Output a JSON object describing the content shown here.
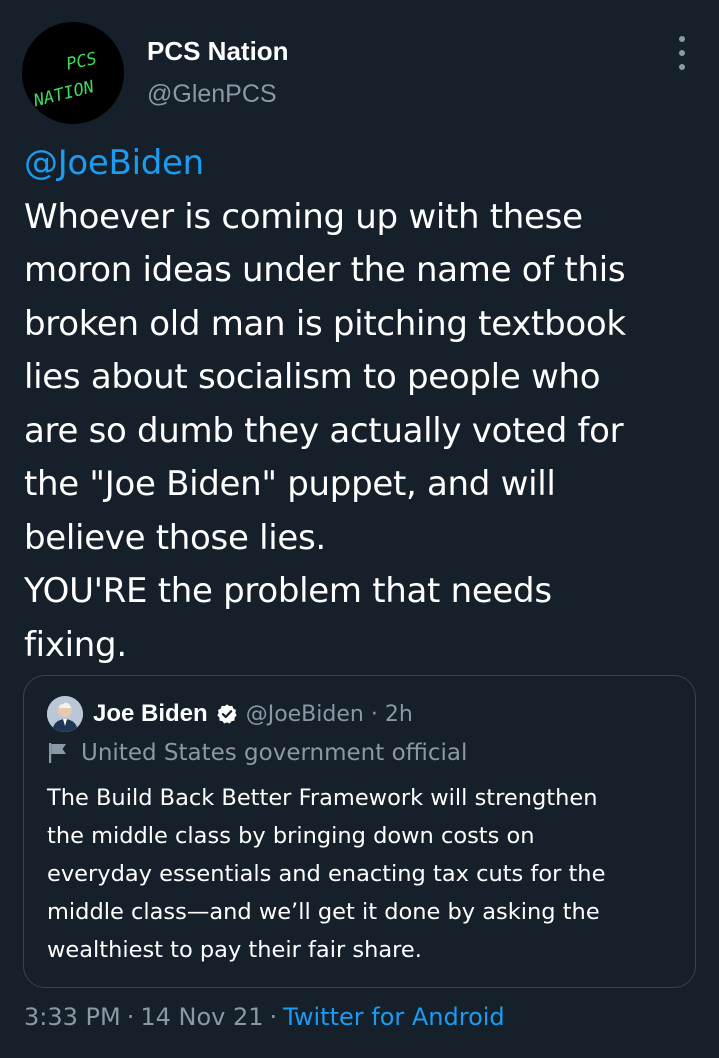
{
  "tweet": {
    "author_name": "PCS Nation",
    "author_handle": "@GlenPCS",
    "avatar_text_1": "PCS",
    "avatar_text_2": "NATION",
    "mention": "@JoeBiden",
    "body_lines": [
      "Whoever is coming up with these",
      "moron ideas under the name of this",
      "broken old man is pitching textbook",
      "lies about socialism to people who",
      "are so dumb they actually voted for",
      "the \"Joe Biden\" puppet, and will",
      "believe those lies.",
      "YOU'RE the problem that needs",
      "fixing."
    ],
    "time": "3:33 PM",
    "date": "14 Nov 21",
    "source": "Twitter for Android",
    "separator": "·"
  },
  "quoted": {
    "name": "Joe Biden",
    "handle": "@JoeBiden",
    "separator": "·",
    "time": "2h",
    "label": "United States government official",
    "body_lines": [
      "The Build Back Better Framework will strengthen",
      "the middle class by bringing down costs on",
      "everyday essentials and enacting tax cuts for the",
      "middle class—and we’ll get it done by asking the",
      "wealthiest to pay their fair share."
    ]
  },
  "colors": {
    "background": "#15202b",
    "link": "#1d9bf0",
    "muted": "#8b98a5",
    "avatar_text": "#3ddc5f",
    "border": "#38444d"
  },
  "icons": {
    "more": "more-vertical-icon",
    "verified": "verified-badge-icon",
    "label": "flag-icon"
  }
}
